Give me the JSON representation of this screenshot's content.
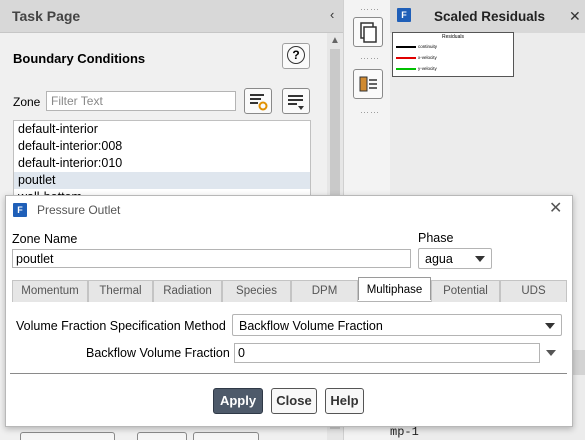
{
  "task_page": {
    "title": "Task Page",
    "heading": "Boundary Conditions",
    "zone_label": "Zone",
    "filter_placeholder": "Filter Text",
    "zones": [
      "default-interior",
      "default-interior:008",
      "default-interior:010",
      "poutlet",
      "wall-bottom"
    ],
    "selected_zone": "poutlet"
  },
  "graphics": {
    "tab_title": "Scaled Residuals",
    "plot_title": "Residuals",
    "legend": [
      {
        "label": "continuity",
        "color": "#000000"
      },
      {
        "label": "x-velocity",
        "color": "#e00000"
      },
      {
        "label": "y-velocity",
        "color": "#00c000"
      }
    ],
    "console_line": "mp-1"
  },
  "dialog": {
    "title": "Pressure Outlet",
    "zone_name_label": "Zone Name",
    "zone_name_value": "poutlet",
    "phase_label": "Phase",
    "phase_value": "agua",
    "tabs": [
      "Momentum",
      "Thermal",
      "Radiation",
      "Species",
      "DPM",
      "Multiphase",
      "Potential",
      "UDS"
    ],
    "active_tab": "Multiphase",
    "vf_spec_label": "Volume Fraction Specification Method",
    "vf_spec_value": "Backflow Volume Fraction",
    "backflow_label": "Backflow Volume Fraction",
    "backflow_value": "0",
    "buttons": {
      "apply": "Apply",
      "close": "Close",
      "help": "Help"
    }
  },
  "colors": {
    "accent": "#4e5a6a",
    "app_icon": "#1f5fb8",
    "selection": "#dfe6ee"
  }
}
